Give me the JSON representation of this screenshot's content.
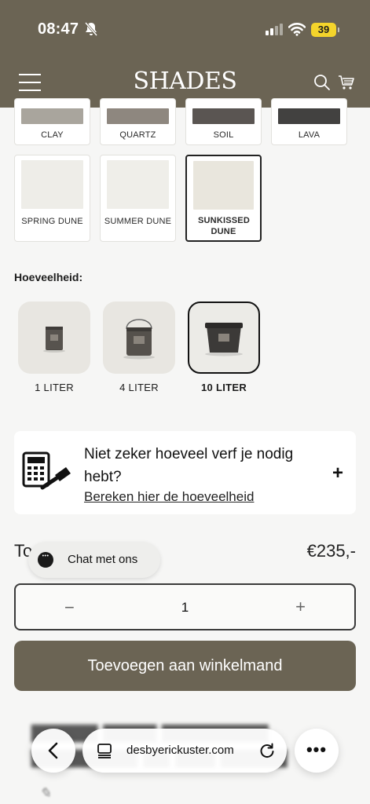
{
  "status_bar": {
    "time": "08:47",
    "battery": "39"
  },
  "header": {
    "logo": "SHADES"
  },
  "swatches_top": [
    {
      "label": "CLAY",
      "color": "#a9a59d"
    },
    {
      "label": "QUARTZ",
      "color": "#8e877f"
    },
    {
      "label": "SOIL",
      "color": "#5a5552"
    },
    {
      "label": "LAVA",
      "color": "#424140"
    }
  ],
  "swatches": [
    {
      "label": "SPRING DUNE",
      "color": "#eeede8"
    },
    {
      "label": "SUMMER DUNE",
      "color": "#efeee9"
    },
    {
      "label": "SUNKISSED DUNE",
      "color": "#e9e6dd"
    }
  ],
  "quantity": {
    "heading": "Hoeveelheid:",
    "options": [
      "1 LITER",
      "4 LITER",
      "10 LITER"
    ]
  },
  "calculator": {
    "title": "Niet zeker hoeveel verf je nodig hebt?",
    "link": "Bereken hier de hoeveelheid",
    "expand": "+"
  },
  "total": {
    "label": "To",
    "price": "€235,-"
  },
  "chat": {
    "label": "Chat met ons"
  },
  "stepper": {
    "minus": "−",
    "value": "1",
    "plus": "+"
  },
  "cart_button": {
    "label": "Toevoegen aan winkelmand"
  },
  "browser": {
    "url": "desbyerickuster.com",
    "more": "•••"
  }
}
